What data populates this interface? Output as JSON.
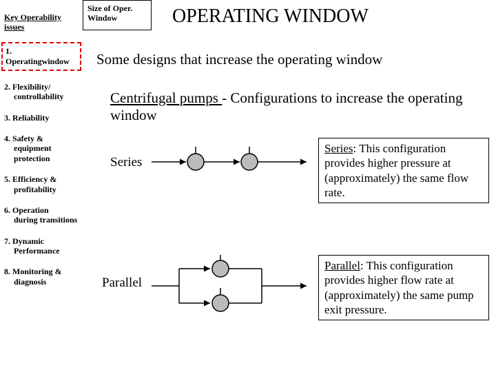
{
  "sidebar": {
    "title": "Key Operability issues",
    "items": [
      {
        "num": "1.",
        "label": "Operating",
        "sub": "window",
        "active": true
      },
      {
        "num": "2.",
        "label": "Flexibility/",
        "sub": "controllability"
      },
      {
        "num": "3.",
        "label": "Reliability"
      },
      {
        "num": "4.",
        "label": "Safety &",
        "sub": "equipment protection"
      },
      {
        "num": "5.",
        "label": "Efficiency &",
        "sub": "profitability"
      },
      {
        "num": "6.",
        "label": "Operation",
        "sub": "during transitions"
      },
      {
        "num": "7.",
        "label": "Dynamic",
        "sub": "Performance"
      },
      {
        "num": "8.",
        "label": "Monitoring &",
        "sub": "diagnosis"
      }
    ]
  },
  "top_box": "Size of Oper. Window",
  "title": "OPERATING WINDOW",
  "subtitle": "Some designs that increase the operating window",
  "pump_heading_u": "Centrifugal pumps ",
  "pump_heading_rest": "- Configurations to increase the operating window",
  "configs": {
    "series": {
      "label": "Series",
      "desc_u": "Series",
      "desc_rest": ": This configuration provides higher pressure at (approximately) the same flow rate."
    },
    "parallel": {
      "label": "Parallel",
      "desc_u": "Parallel",
      "desc_rest": ": This configuration provides higher flow rate at (approximately) the same pump exit pressure."
    }
  }
}
